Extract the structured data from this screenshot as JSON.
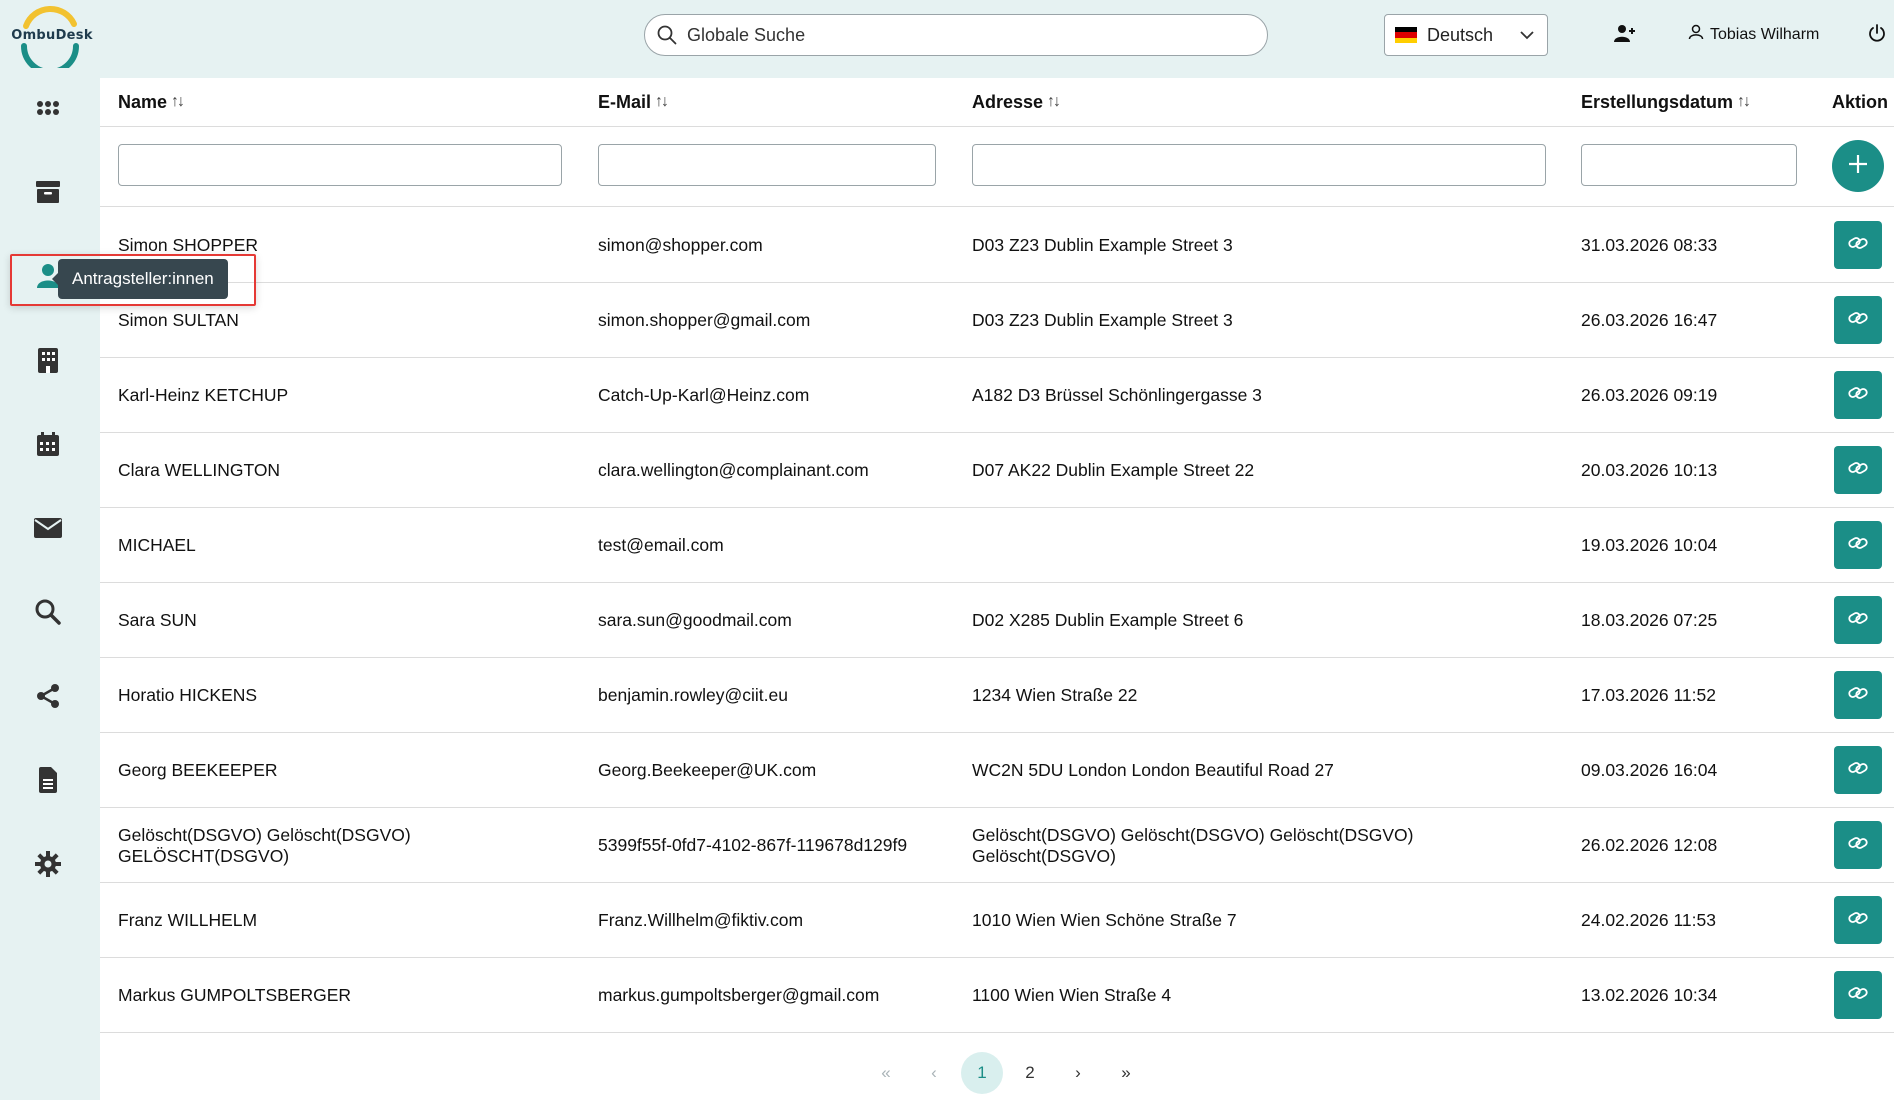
{
  "brand": {
    "name": "OmbuDesk",
    "color": "#1b8e87"
  },
  "search": {
    "placeholder": "Globale Suche"
  },
  "language": {
    "selected": "Deutsch",
    "flag": "de-flag-icon"
  },
  "user": {
    "name": "Tobias Wilharm"
  },
  "sidebar": {
    "tooltip": "Antragsteller:innen",
    "items": [
      {
        "icon": "grid-icon"
      },
      {
        "icon": "archive-icon"
      },
      {
        "icon": "person-icon"
      },
      {
        "icon": "building-icon"
      },
      {
        "icon": "calendar-icon"
      },
      {
        "icon": "envelope-icon"
      },
      {
        "icon": "search-icon"
      },
      {
        "icon": "share-icon"
      },
      {
        "icon": "document-icon"
      },
      {
        "icon": "gear-icon"
      }
    ]
  },
  "table": {
    "columns": [
      {
        "label": "Name",
        "sortable": true
      },
      {
        "label": "E-Mail",
        "sortable": true
      },
      {
        "label": "Adresse",
        "sortable": true
      },
      {
        "label": "Erstellungsdatum",
        "sortable": true
      },
      {
        "label": "Aktion",
        "sortable": false
      }
    ],
    "sort_glyph": "↑↓",
    "rows": [
      {
        "name": "Simon SHOPPER",
        "email": "simon@shopper.com",
        "address": "D03 Z23 Dublin Example Street 3",
        "date": "31.03.2026 08:33"
      },
      {
        "name": "Simon SULTAN",
        "email": "simon.shopper@gmail.com",
        "address": "D03 Z23 Dublin Example Street 3",
        "date": "26.03.2026 16:47"
      },
      {
        "name": "Karl-Heinz KETCHUP",
        "email": "Catch-Up-Karl@Heinz.com",
        "address": "A182 D3 Brüssel Schönlingergasse 3",
        "date": "26.03.2026 09:19"
      },
      {
        "name": "Clara WELLINGTON",
        "email": "clara.wellington@complainant.com",
        "address": "D07 AK22 Dublin Example Street 22",
        "date": "20.03.2026 10:13"
      },
      {
        "name": "MICHAEL",
        "email": "test@email.com",
        "address": "",
        "date": "19.03.2026 10:04"
      },
      {
        "name": "Sara SUN",
        "email": "sara.sun@goodmail.com",
        "address": "D02 X285 Dublin Example Street 6",
        "date": "18.03.2026 07:25"
      },
      {
        "name": "Horatio HICKENS",
        "email": "benjamin.rowley@ciit.eu",
        "address": "1234 Wien Straße 22",
        "date": "17.03.2026 11:52"
      },
      {
        "name": "Georg BEEKEEPER",
        "email": "Georg.Beekeeper@UK.com",
        "address": "WC2N 5DU London London Beautiful Road 27",
        "date": "09.03.2026 16:04"
      },
      {
        "name": "Gelöscht(DSGVO) Gelöscht(DSGVO) GELÖSCHT(DSGVO)",
        "email": "5399f55f-0fd7-4102-867f-119678d129f9",
        "address": "Gelöscht(DSGVO) Gelöscht(DSGVO) Gelöscht(DSGVO) Gelöscht(DSGVO)",
        "date": "26.02.2026 12:08"
      },
      {
        "name": "Franz WILLHELM",
        "email": "Franz.Willhelm@fiktiv.com",
        "address": "1010 Wien Wien Schöne Straße 7",
        "date": "24.02.2026 11:53"
      },
      {
        "name": "Markus GUMPOLTSBERGER",
        "email": "markus.gumpoltsberger@gmail.com",
        "address": "1100 Wien Wien Straße 4",
        "date": "13.02.2026 10:34"
      }
    ]
  },
  "pagination": {
    "first": "«",
    "prev": "‹",
    "next": "›",
    "last": "»",
    "pages": [
      "1",
      "2"
    ],
    "current": "1"
  }
}
